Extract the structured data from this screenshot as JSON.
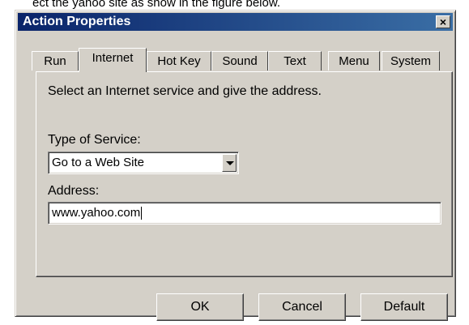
{
  "caption_fragment": "ect the yahoo site as show in the figure below.",
  "window": {
    "title": "Action Properties",
    "close_glyph": "×"
  },
  "tabs": [
    {
      "label": "Run",
      "active": false
    },
    {
      "label": "Internet",
      "active": true
    },
    {
      "label": "Hot Key",
      "active": false
    },
    {
      "label": "Sound",
      "active": false
    },
    {
      "label": "Text",
      "active": false
    },
    {
      "label": "Menu",
      "active": false
    },
    {
      "label": "System",
      "active": false
    }
  ],
  "panel": {
    "instruction": "Select an Internet service and give the address.",
    "service_label": "Type of Service:",
    "service_value": "Go to a Web Site",
    "address_label": "Address:",
    "address_value": "www.yahoo.com"
  },
  "buttons": {
    "ok": "OK",
    "cancel": "Cancel",
    "default": "Default"
  },
  "colors": {
    "titlebar_start": "#0a246a",
    "titlebar_end": "#3a6ea5",
    "face": "#d4d0c8"
  }
}
